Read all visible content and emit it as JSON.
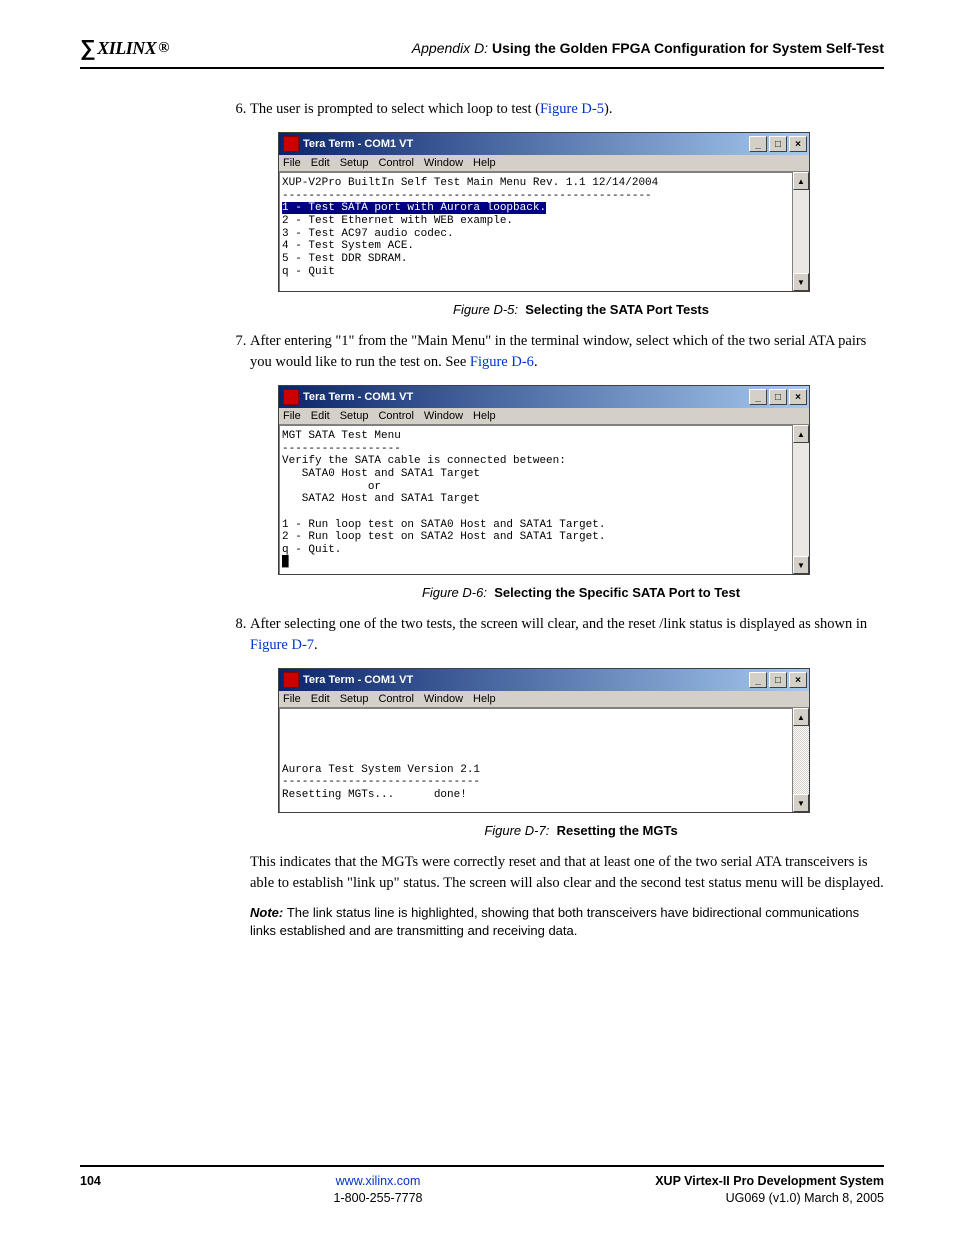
{
  "header": {
    "logo_text": "XILINX",
    "logo_reg": "®",
    "appendix_label": "Appendix D:",
    "appendix_title": "Using the Golden FPGA Configuration for System Self-Test"
  },
  "steps": {
    "start": 6,
    "items": [
      {
        "pre": "The user is prompted to select which loop to test (",
        "ref": "Figure D-5",
        "post": ")."
      },
      {
        "pre": "After entering \"1\" from the \"Main Menu\" in the terminal window, select which of the two serial ATA pairs you would like to run the test on. See ",
        "ref": "Figure D-6",
        "post": "."
      },
      {
        "pre": "After selecting one of the two tests, the screen will clear, and the reset /link status is displayed as shown in ",
        "ref": "Figure D-7",
        "post": "."
      }
    ]
  },
  "terminal": {
    "title": "Tera Term - COM1 VT",
    "menu": [
      "File",
      "Edit",
      "Setup",
      "Control",
      "Window",
      "Help"
    ],
    "win_min": "_",
    "win_max": "□",
    "win_close": "×",
    "scroll_up": "▲",
    "scroll_down": "▼",
    "fig5": {
      "line1": "XUP-V2Pro BuiltIn Self Test Main Menu Rev. 1.1 12/14/2004",
      "divider": "--------------------------------------------------------",
      "hl": "1 - Test SATA port with Aurora loopback.",
      "line2": "2 - Test Ethernet with WEB example.",
      "line3": "3 - Test AC97 audio codec.",
      "line4": "4 - Test System ACE.",
      "line5": "5 - Test DDR SDRAM.",
      "line6": "q - Quit"
    },
    "fig6": {
      "line1": "MGT SATA Test Menu",
      "divider": "------------------",
      "line2": "Verify the SATA cable is connected between:",
      "line3": "   SATA0 Host and SATA1 Target",
      "line4": "             or",
      "line5": "   SATA2 Host and SATA1 Target",
      "line6": "1 - Run loop test on SATA0 Host and SATA1 Target.",
      "line7": "2 - Run loop test on SATA2 Host and SATA1 Target.",
      "line8": "q - Quit.",
      "cursor": "█"
    },
    "fig7": {
      "line1": "Aurora Test System Version 2.1",
      "divider": "------------------------------",
      "line2": "Resetting MGTs...      done!"
    }
  },
  "captions": {
    "fig5_label": "Figure D-5:",
    "fig5_title": "Selecting the SATA Port Tests",
    "fig6_label": "Figure D-6:",
    "fig6_title": "Selecting the Specific SATA Port to Test",
    "fig7_label": "Figure D-7:",
    "fig7_title": "Resetting the MGTs"
  },
  "post_para": "This indicates that the MGTs were correctly reset and that at least one of the two serial ATA transceivers is able to establish \"link up\" status. The screen will also clear and the second test status menu will be displayed.",
  "note": {
    "label": "Note:",
    "text": "The link status line is highlighted, showing that both transceivers have bidirectional communications links established and are transmitting and receiving data."
  },
  "footer": {
    "page": "104",
    "url": "www.xilinx.com",
    "phone": "1-800-255-7778",
    "doc_title": "XUP  Virtex-II Pro Development System",
    "doc_rev": "UG069 (v1.0) March 8, 2005"
  }
}
